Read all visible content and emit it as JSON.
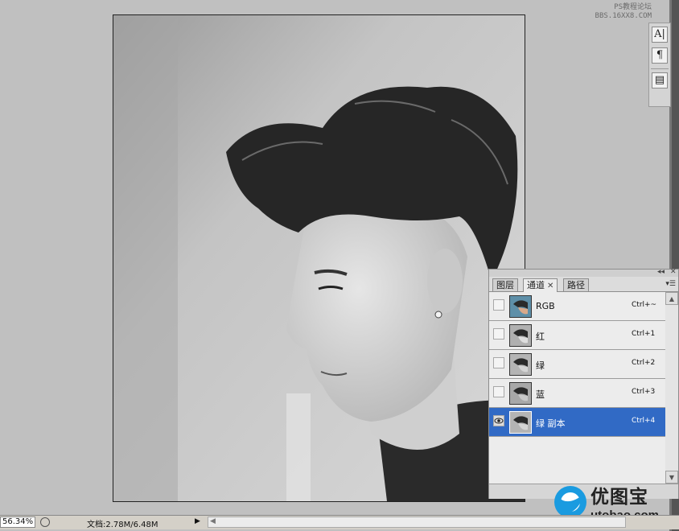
{
  "watermark": {
    "line1": "PS教程论坛",
    "line2": "BBS.16XX8.COM"
  },
  "dock": {
    "tools": [
      {
        "icon": "character-icon",
        "glyph": "A|"
      },
      {
        "icon": "paragraph-icon",
        "glyph": "¶"
      },
      {
        "icon": "navigator-icon",
        "glyph": "▤"
      }
    ]
  },
  "panel": {
    "tabs": [
      {
        "label": "图层",
        "active": false
      },
      {
        "label": "通道",
        "active": true
      },
      {
        "label": "路径",
        "active": false
      }
    ],
    "channels": [
      {
        "name": "RGB",
        "shortcut": "Ctrl+~",
        "visible": false,
        "selected": false,
        "thumb": "color"
      },
      {
        "name": "红",
        "shortcut": "Ctrl+1",
        "visible": false,
        "selected": false,
        "thumb": "gray"
      },
      {
        "name": "绿",
        "shortcut": "Ctrl+2",
        "visible": false,
        "selected": false,
        "thumb": "gray"
      },
      {
        "name": "蓝",
        "shortcut": "Ctrl+3",
        "visible": false,
        "selected": false,
        "thumb": "gray"
      },
      {
        "name": "绿 副本",
        "shortcut": "Ctrl+4",
        "visible": true,
        "selected": true,
        "thumb": "gray"
      }
    ],
    "selected_color": "#316ac5"
  },
  "logo": {
    "cn": "优图宝",
    "en": "utobao.com"
  },
  "status": {
    "zoom": "56.34%",
    "doc_info": "文档:2.78M/6.48M"
  }
}
